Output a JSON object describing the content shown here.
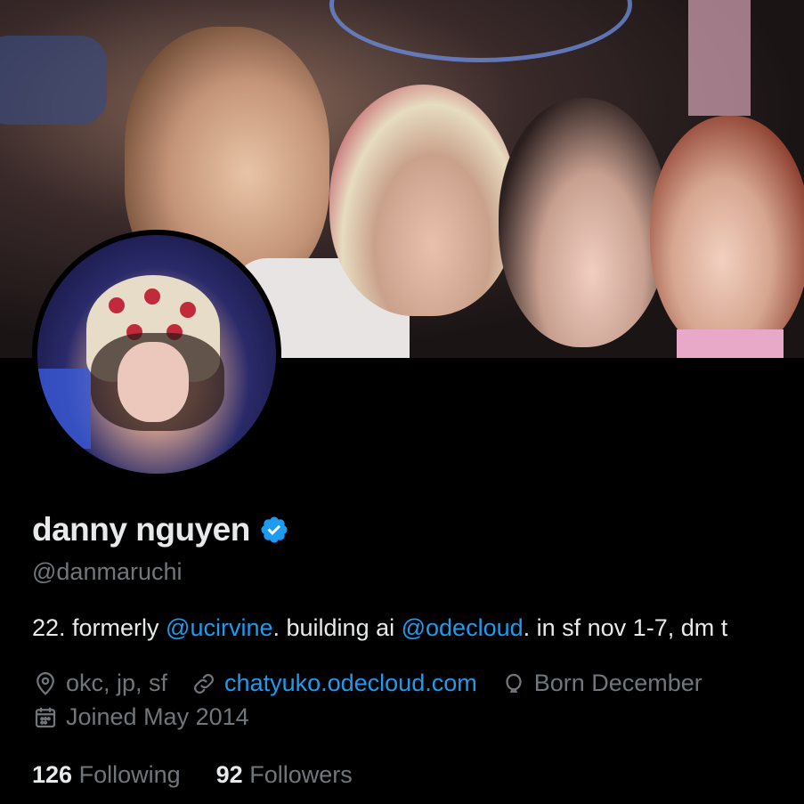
{
  "profile": {
    "name": "danny nguyen",
    "handle": "@danmaruchi",
    "bio": {
      "part1": "22. formerly ",
      "mention1": "@ucirvine",
      "part2": ". building ai ",
      "mention2": "@odecloud",
      "part3": ". in sf nov 1-7, dm t"
    },
    "location": "okc, jp, sf",
    "website": "chatyuko.odecloud.com",
    "birthday": "Born December",
    "joined": "Joined May 2014",
    "following_count": "126",
    "following_label": "Following",
    "followers_count": "92",
    "followers_label": "Followers"
  },
  "icons": {
    "verified": "verified-badge-icon",
    "location": "location-pin-icon",
    "link": "link-icon",
    "birthday": "balloon-icon",
    "joined": "calendar-icon"
  },
  "colors": {
    "background": "#000000",
    "text": "#e7e9ea",
    "muted": "#71767b",
    "link": "#1d9bf0"
  }
}
